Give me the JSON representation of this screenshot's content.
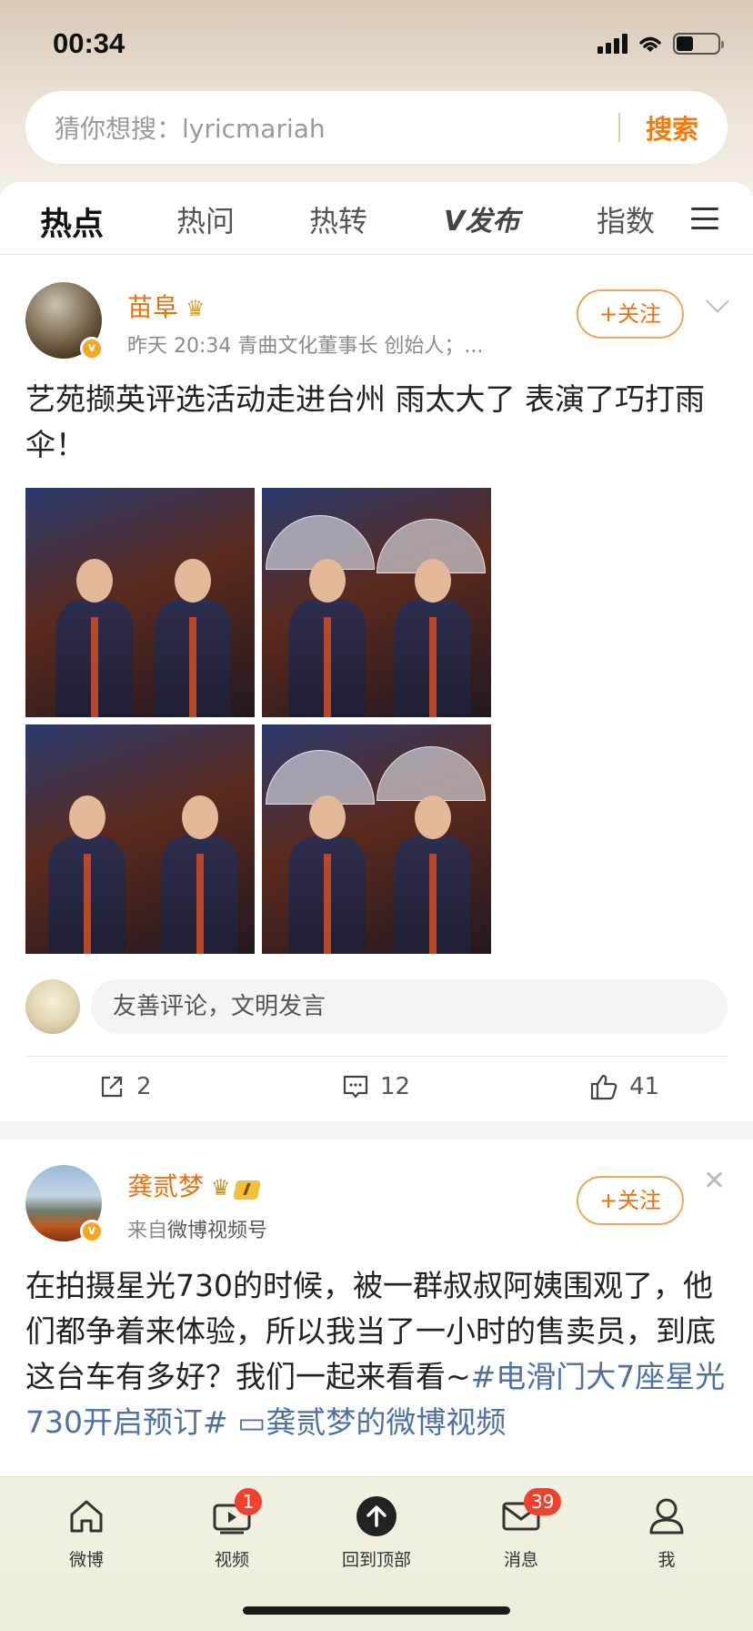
{
  "status_bar": {
    "time": "00:34"
  },
  "search": {
    "placeholder": "猜你想搜：lyricmariah",
    "button": "搜索"
  },
  "tabs": [
    {
      "label": "热点",
      "active": true
    },
    {
      "label": "热问"
    },
    {
      "label": "热转"
    },
    {
      "label": "V发布"
    },
    {
      "label": "指数"
    }
  ],
  "posts": [
    {
      "author": "苗阜",
      "meta": "昨天 20:34  青曲文化董事长 创始人；...",
      "follow": "+关注",
      "text": "艺苑撷英评选活动走进台州 雨太大了 表演了巧打雨伞！",
      "comment_placeholder": "友善评论，文明发言",
      "counts": {
        "share": "2",
        "comment": "12",
        "like": "41"
      }
    },
    {
      "author": "龚贰梦",
      "level": "I",
      "meta_prefix": "来自",
      "meta_source": "微博视频号",
      "follow": "+关注",
      "text": "在拍摄星光730的时候，被一群叔叔阿姨围观了，他们都争着来体验，所以我当了一小时的售卖员，到底这台车有多好？我们一起来看看~",
      "topic": "#电滑门大7座星光730开启预订#",
      "video_link": "龚贰梦的微博视频"
    }
  ],
  "bottom_nav": [
    {
      "label": "微博",
      "icon": "home-icon"
    },
    {
      "label": "视频",
      "icon": "video-icon",
      "badge": "1"
    },
    {
      "label": "回到顶部",
      "icon": "arrow-up-icon"
    },
    {
      "label": "消息",
      "icon": "mail-icon",
      "badge": "39"
    },
    {
      "label": "我",
      "icon": "profile-icon"
    }
  ],
  "colors": {
    "accent": "#f07d14",
    "topic_link": "#4f6fa8",
    "badge": "#f0402e"
  }
}
